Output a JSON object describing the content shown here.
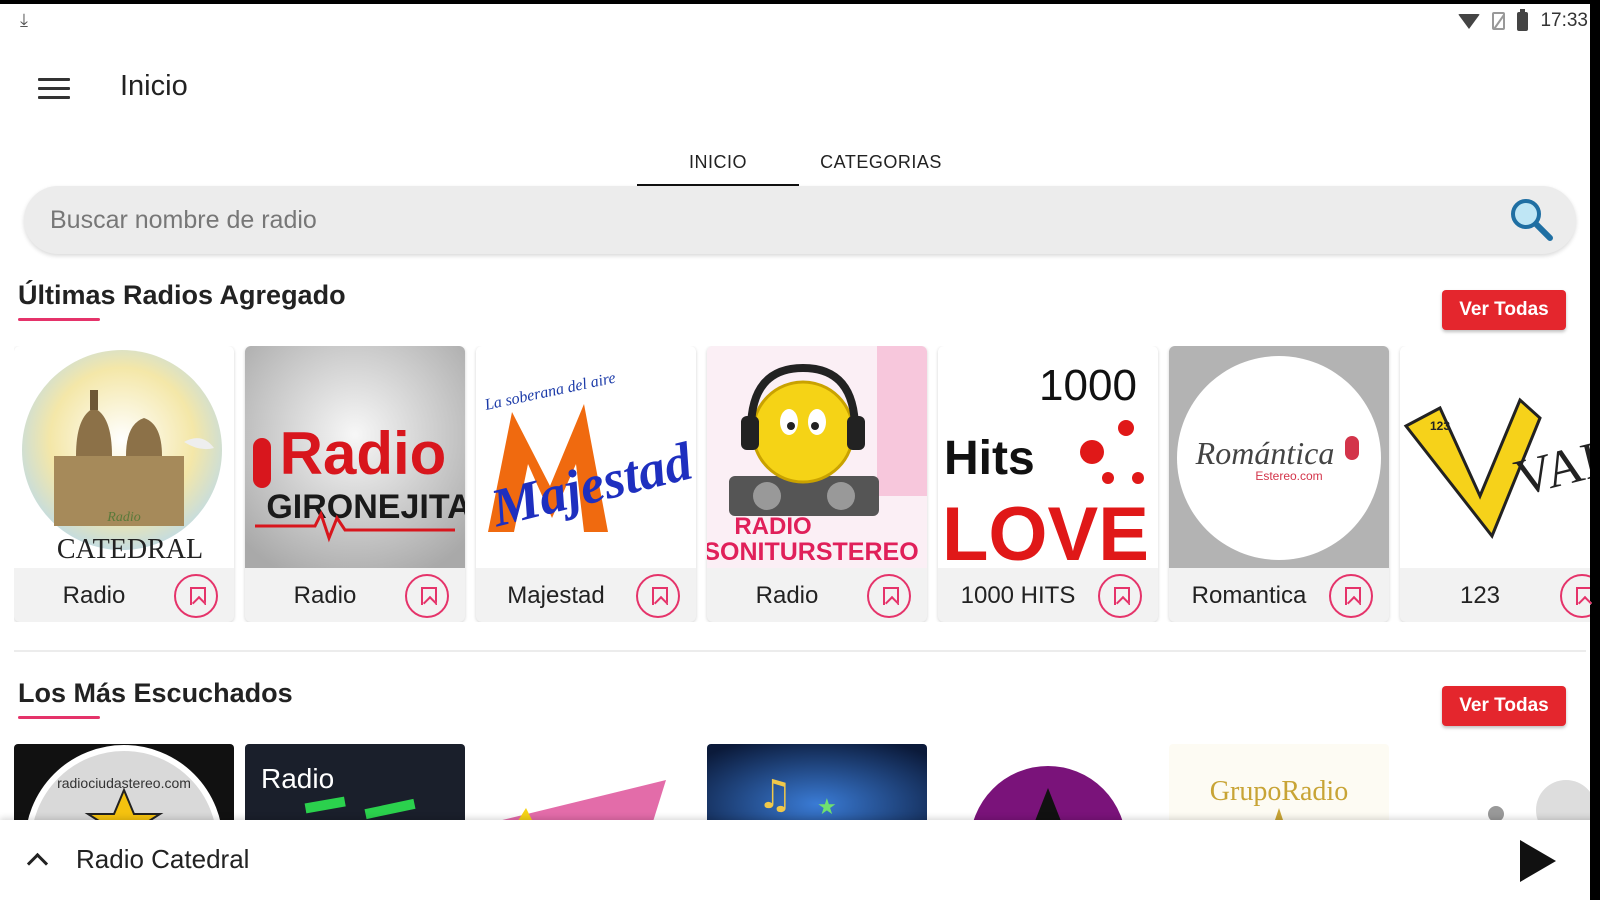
{
  "status_bar": {
    "time": "17:33",
    "icons": [
      "download-icon",
      "wifi-icon",
      "no-sim-icon",
      "battery-icon"
    ]
  },
  "app_bar": {
    "title": "Inicio",
    "menu_icon": "menu-icon"
  },
  "tabs": [
    {
      "label": "INICIO",
      "selected": true
    },
    {
      "label": "CATEGORIAS",
      "selected": false
    }
  ],
  "search": {
    "placeholder": "Buscar nombre de radio",
    "icon": "search-icon"
  },
  "sections": [
    {
      "title": "Últimas Radios Agregado",
      "action": "Ver Todas",
      "cards": [
        {
          "label": "Radio",
          "art_text": "CATEDRAL",
          "art_subtext": "Radio"
        },
        {
          "label": "Radio",
          "art_text": "Radio",
          "art_subtext": "GIRONEJITA"
        },
        {
          "label": "Majestad",
          "art_text": "Majestad",
          "art_subtext": "La soberana del aire"
        },
        {
          "label": "Radio",
          "art_text": "RADIO",
          "art_subtext": "SONITURSTEREO"
        },
        {
          "label": "1000 HITS",
          "art_text": "1000",
          "art_subtext": "Hits LOVE"
        },
        {
          "label": "Romantica",
          "art_text": "Romántica",
          "art_subtext": "Estereo.com"
        },
        {
          "label": "123",
          "art_text": "VALLEN",
          "art_subtext": "123"
        }
      ]
    },
    {
      "title": "Los Más Escuchados",
      "action": "Ver Todas",
      "thumbs": [
        {
          "art_text": "radiociudastereo.com"
        },
        {
          "art_text": "Radio"
        },
        {
          "art_text": ""
        },
        {
          "art_text": ""
        },
        {
          "art_text": ""
        },
        {
          "art_text": "GrupoRadio"
        },
        {
          "art_text": ""
        }
      ]
    }
  ],
  "player": {
    "title": "Radio Catedral",
    "expand_icon": "chevron-up-icon",
    "play_icon": "play-icon"
  },
  "colors": {
    "accent": "#e5336a",
    "button_red": "#e4262d",
    "search_bg": "#ececec"
  }
}
